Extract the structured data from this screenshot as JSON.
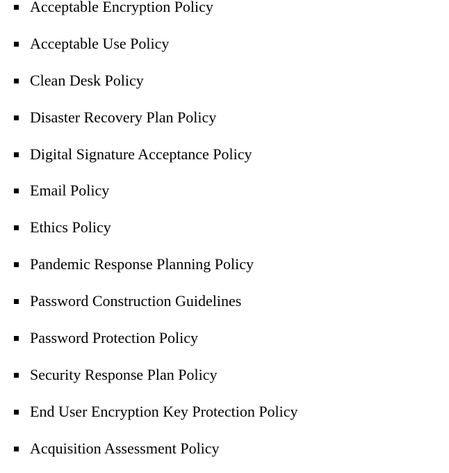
{
  "list": {
    "items": [
      {
        "label": "Acceptable Encryption Policy",
        "icon": "square-bullet-icon"
      },
      {
        "label": "Acceptable Use Policy",
        "icon": "square-bullet-icon"
      },
      {
        "label": "Clean Desk Policy",
        "icon": "square-bullet-icon"
      },
      {
        "label": "Disaster Recovery Plan Policy",
        "icon": "square-bullet-icon"
      },
      {
        "label": "Digital Signature Acceptance Policy",
        "icon": "square-bullet-icon"
      },
      {
        "label": "Email Policy",
        "icon": "square-bullet-icon"
      },
      {
        "label": "Ethics Policy",
        "icon": "square-bullet-icon"
      },
      {
        "label": "Pandemic Response Planning Policy",
        "icon": "square-bullet-icon"
      },
      {
        "label": "Password Construction Guidelines",
        "icon": "square-bullet-icon"
      },
      {
        "label": "Password Protection Policy",
        "icon": "square-bullet-icon"
      },
      {
        "label": "Security Response Plan Policy",
        "icon": "square-bullet-icon"
      },
      {
        "label": "End User Encryption Key Protection Policy",
        "icon": "square-bullet-icon"
      },
      {
        "label": "Acquisition Assessment Policy",
        "icon": "square-bullet-icon"
      }
    ]
  }
}
